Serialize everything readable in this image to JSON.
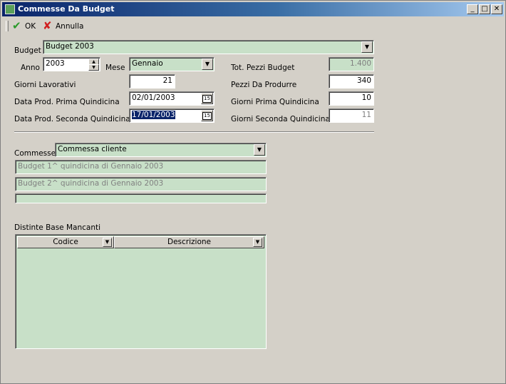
{
  "window": {
    "title": "Commesse Da Budget",
    "controls": {
      "minimize": "_",
      "maximize": "□",
      "close": "✕"
    }
  },
  "toolbar": {
    "ok_label": "OK",
    "annulla_label": "Annulla"
  },
  "form": {
    "budget_label": "Budget",
    "budget_value": "Budget 2003",
    "anno_label": "Anno",
    "anno_value": "2003",
    "mese_label": "Mese",
    "mese_value": "Gennaio",
    "giorni_lavorativi_label": "Giorni Lavorativi",
    "giorni_lavorativi_value": "21",
    "data_prima_label": "Data Prod. Prima Quindicina",
    "data_prima_value": "02/01/2003",
    "data_seconda_label": "Data Prod. Seconda Quindicina",
    "data_seconda_value": "17/01/2003",
    "tot_pezzi_label": "Tot. Pezzi Budget",
    "tot_pezzi_value": "1.400",
    "pezzi_produrre_label": "Pezzi Da Produrre",
    "pezzi_produrre_value": "340",
    "giorni_prima_label": "Giorni Prima Quindicina",
    "giorni_prima_value": "10",
    "giorni_seconda_label": "Giorni Seconda Quindicina",
    "giorni_seconda_value": "11"
  },
  "commesse": {
    "label": "Commesse",
    "selected": "Commessa cliente",
    "line1": "Budget 1^ quindicina di Gennaio 2003",
    "line2": "Budget 2^ quindicina di Gennaio 2003",
    "line3": ""
  },
  "distinte": {
    "label": "Distinte Base Mancanti",
    "columns": [
      "Codice",
      "Descrizione"
    ]
  },
  "icons": {
    "dropdown": "▼",
    "spin_up": "▲",
    "spin_down": "▼",
    "calendar": "15",
    "ok": "✔",
    "annulla": "✘"
  },
  "colors": {
    "field_green": "#c8e0c8",
    "title_dark": "#0a246a",
    "ok_green": "#2a9a2a",
    "annulla_red": "#d02020"
  }
}
